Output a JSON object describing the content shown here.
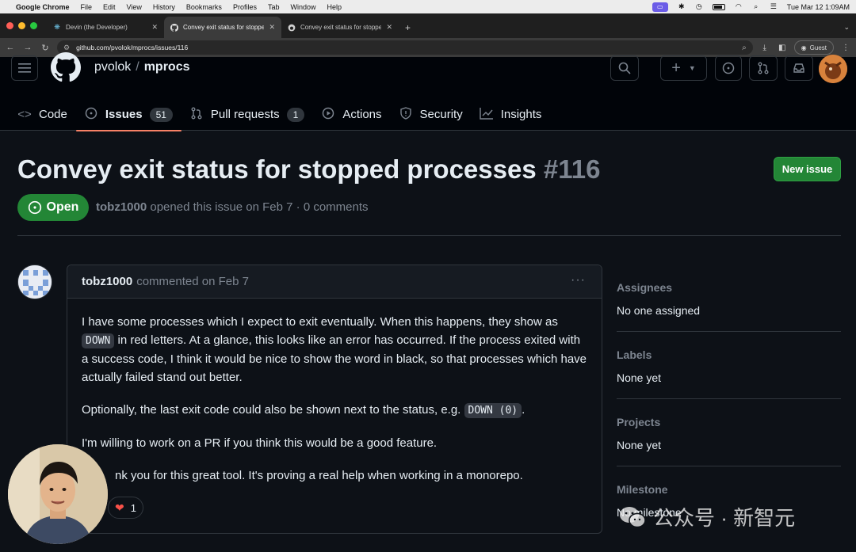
{
  "menubar": {
    "app": "Google Chrome",
    "items": [
      "File",
      "Edit",
      "View",
      "History",
      "Bookmarks",
      "Profiles",
      "Tab",
      "Window",
      "Help"
    ],
    "datetime": "Tue Mar 12  1:09AM"
  },
  "tabs": [
    {
      "title": "Devin (the Developer)",
      "active": false
    },
    {
      "title": "Convey exit status for stoppe",
      "active": true
    },
    {
      "title": "Convey exit status for stoppe",
      "active": false
    }
  ],
  "address": {
    "url": "github.com/pvolok/mprocs/issues/116",
    "profile": "Guest"
  },
  "repo": {
    "owner": "pvolok",
    "separator": "/",
    "name": "mprocs"
  },
  "repo_nav": [
    {
      "label": "Code",
      "icon": "code-icon",
      "count": null,
      "selected": false
    },
    {
      "label": "Issues",
      "icon": "issue-icon",
      "count": "51",
      "selected": true
    },
    {
      "label": "Pull requests",
      "icon": "pull-request-icon",
      "count": "1",
      "selected": false
    },
    {
      "label": "Actions",
      "icon": "play-icon",
      "count": null,
      "selected": false
    },
    {
      "label": "Security",
      "icon": "shield-icon",
      "count": null,
      "selected": false
    },
    {
      "label": "Insights",
      "icon": "graph-icon",
      "count": null,
      "selected": false
    }
  ],
  "issue": {
    "title": "Convey exit status for stopped processes",
    "number": "#116",
    "state": "Open",
    "author": "tobz1000",
    "meta_rest": "opened this issue on Feb 7 · 0 comments",
    "new_issue_label": "New issue"
  },
  "comment": {
    "author": "tobz1000",
    "when": "commented on Feb 7",
    "menu": "···",
    "p1_a": "I have some processes which I expect to exit eventually. When this happens, they show as ",
    "p1_code": "DOWN",
    "p1_b": " in red letters. At a glance, this looks like an error has occurred. If the process exited with a success code, I think it would be nice to show the word in black, so that processes which have actually failed stand out better.",
    "p2_a": "Optionally, the last exit code could also be shown next to the status, e.g. ",
    "p2_code": "DOWN (0)",
    "p2_b": ".",
    "p3": "I'm willing to work on a PR if you think this would be a good feature.",
    "p4": "nk you for this great tool. It's proving a real help when working in a monorepo.",
    "reaction_count": "1"
  },
  "sidebar": {
    "assignees_label": "Assignees",
    "assignees_value": "No one assigned",
    "labels_label": "Labels",
    "labels_value": "None yet",
    "projects_label": "Projects",
    "projects_value": "None yet",
    "milestone_label": "Milestone",
    "milestone_value": "No milestone"
  },
  "watermark": {
    "text": "公众号 · 新智元"
  },
  "colors": {
    "bg": "#0d1117",
    "header_bg": "#010409",
    "green": "#238636",
    "accent_underline": "#f78166",
    "border": "#30363d",
    "muted": "#7d8590"
  }
}
